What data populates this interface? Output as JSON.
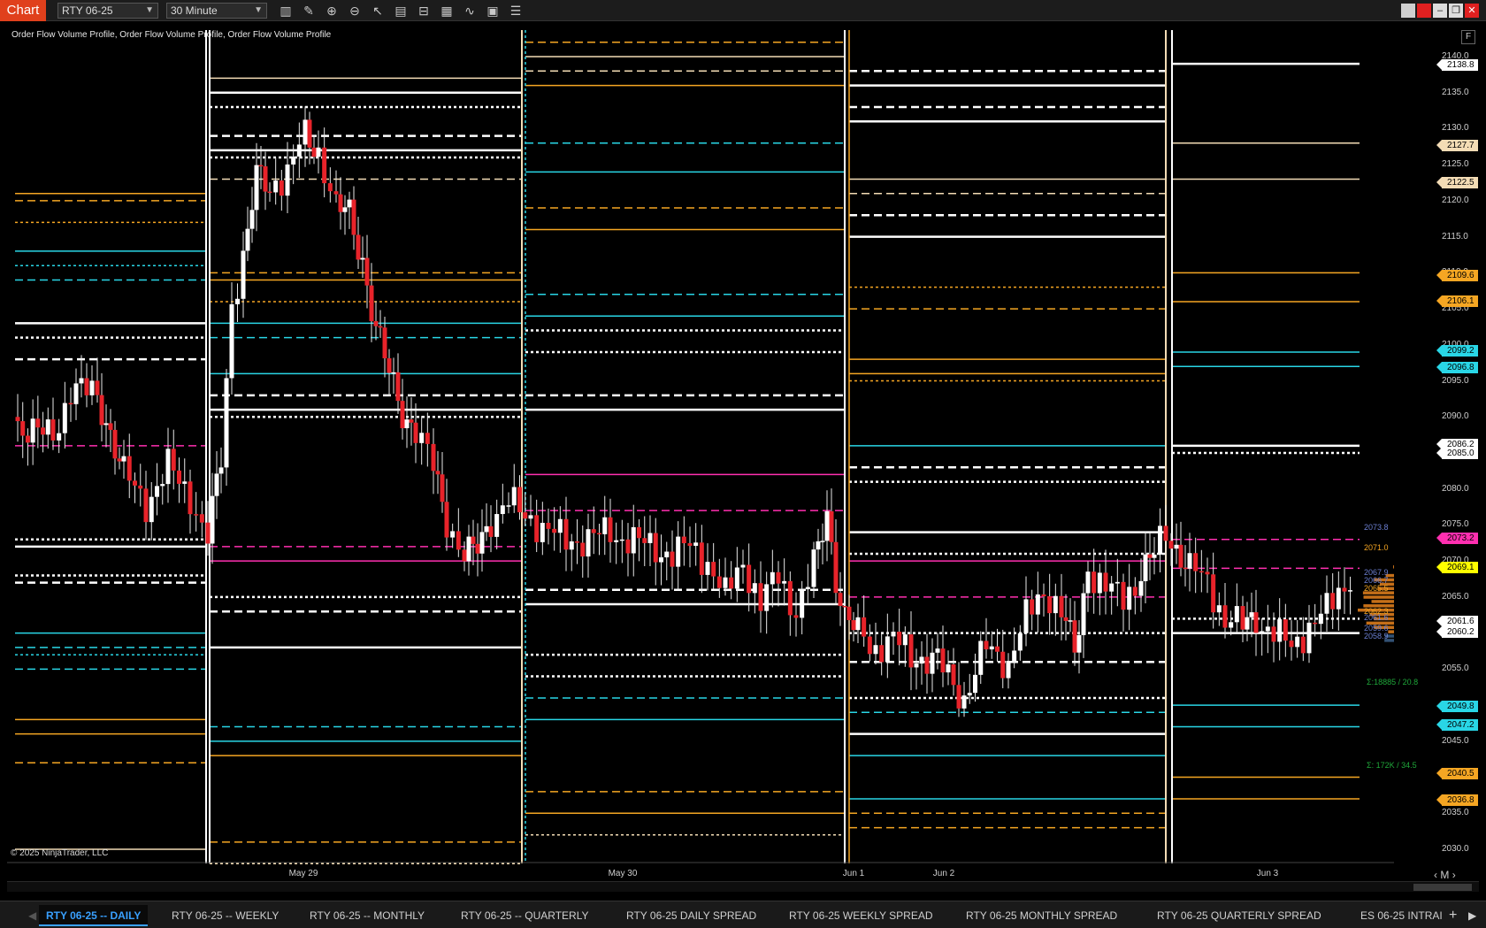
{
  "app": {
    "brand": "Chart",
    "instrument": "RTY 06-25",
    "interval": "30 Minute"
  },
  "toolbar_icons": [
    "bar-style-icon",
    "draw-pencil-icon",
    "zoom-in-icon",
    "zoom-out-icon",
    "pointer-icon",
    "data-box-icon",
    "templates-icon",
    "strategies-icon",
    "indicators-icon",
    "properties-icon",
    "chart-trader-icon"
  ],
  "chart": {
    "indicator_label": "Order Flow Volume Profile, Order Flow Volume Profile, Order Flow Volume Profile",
    "copyright": "© 2025 NinjaTrader, LLC",
    "f_button": "F",
    "dates": [
      "May 29",
      "May 30",
      "Jun 1",
      "Jun 2",
      "Jun 3"
    ],
    "right_axis_ticks": [
      "2140.0",
      "2135.0",
      "2130.0",
      "2125.0",
      "2120.0",
      "2115.0",
      "2110.0",
      "2105.0",
      "2100.0",
      "2095.0",
      "2090.0",
      "2085.0",
      "2080.0",
      "2075.0",
      "2070.0",
      "2065.0",
      "2060.0",
      "2055.0",
      "2050.0",
      "2045.0",
      "2040.0",
      "2035.0",
      "2030.0"
    ],
    "price_tags": [
      {
        "value": "2138.8",
        "color": "#ffffff"
      },
      {
        "value": "2127.7",
        "color": "#f3dcb5"
      },
      {
        "value": "2122.5",
        "color": "#f3dcb5"
      },
      {
        "value": "2109.6",
        "color": "#f5a623"
      },
      {
        "value": "2106.1",
        "color": "#f5a623"
      },
      {
        "value": "2099.2",
        "color": "#29d6e6"
      },
      {
        "value": "2096.8",
        "color": "#29d6e6"
      },
      {
        "value": "2086.2",
        "color": "#ffffff"
      },
      {
        "value": "2085.0",
        "color": "#ffffff"
      },
      {
        "value": "2073.2",
        "color": "#ff2fb0"
      },
      {
        "value": "2069.1",
        "color": "#ffff00"
      },
      {
        "value": "2061.6",
        "color": "#ffffff"
      },
      {
        "value": "2060.2",
        "color": "#ffffff"
      },
      {
        "value": "2049.8",
        "color": "#29d6e6"
      },
      {
        "value": "2047.2",
        "color": "#29d6e6"
      },
      {
        "value": "2040.5",
        "color": "#f5a623"
      },
      {
        "value": "2036.8",
        "color": "#f5a623"
      }
    ],
    "profile_labels": [
      {
        "value": "2073.8",
        "color": "#6b7fd1"
      },
      {
        "value": "2071.0",
        "color": "#f5a623"
      },
      {
        "value": "2067.9",
        "color": "#6b7fd1"
      },
      {
        "value": "2066.7",
        "color": "#6b7fd1"
      },
      {
        "value": "2065.5",
        "color": "#f5a623"
      },
      {
        "value": "2062.3",
        "color": "#f5a623"
      },
      {
        "value": "2061.6",
        "color": "#6b7fd1"
      },
      {
        "value": "2059.6",
        "color": "#6b7fd1"
      },
      {
        "value": "2058.9",
        "color": "#6b7fd1"
      },
      {
        "value": "Σ:18885 / 20.8",
        "color": "#1fa83a"
      },
      {
        "value": "Σ: 172K / 34.5",
        "color": "#1fa83a"
      }
    ],
    "zoom_label": "M"
  },
  "tabs": [
    {
      "label": "RTY 06-25 -- DAILY",
      "active": true
    },
    {
      "label": "RTY 06-25 -- WEEKLY",
      "active": false
    },
    {
      "label": "RTY 06-25 -- MONTHLY",
      "active": false
    },
    {
      "label": "RTY 06-25 -- QUARTERLY",
      "active": false
    },
    {
      "label": "RTY 06-25 DAILY SPREAD",
      "active": false
    },
    {
      "label": "RTY 06-25 WEEKLY SPREAD",
      "active": false
    },
    {
      "label": "RTY 06-25 MONTHLY SPREAD",
      "active": false
    },
    {
      "label": "RTY 06-25 QUARTERLY SPREAD",
      "active": false
    },
    {
      "label": "ES 06-25 INTRAI",
      "active": false
    }
  ],
  "colors": {
    "up_candle": "#ffffff",
    "down_candle": "#e8232a",
    "white_level": "#ffffff",
    "tan_level": "#f3dcb5",
    "orange_level": "#f5a623",
    "cyan_level": "#29d6e6",
    "magenta_level": "#ff2fb0"
  }
}
